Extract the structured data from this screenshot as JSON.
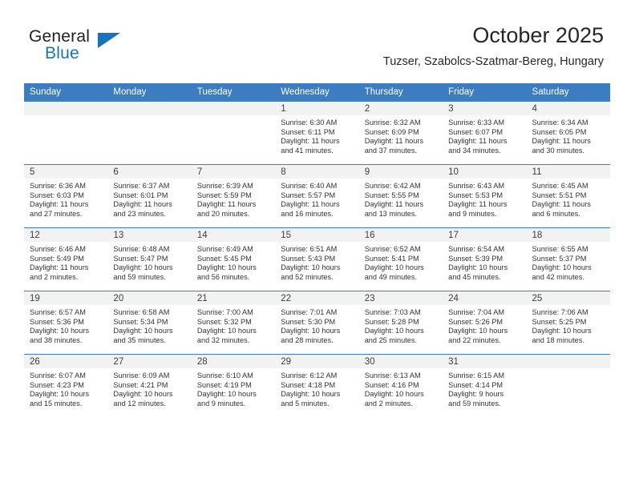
{
  "brand": {
    "name_part1": "General",
    "name_part2": "Blue",
    "accent_color": "#1c72ba"
  },
  "header": {
    "month_title": "October 2025",
    "location": "Tuzser, Szabolcs-Szatmar-Bereg, Hungary"
  },
  "calendar": {
    "header_bg": "#3b7dc0",
    "daynum_bg": "#f2f2f2",
    "weekday_headers": [
      "Sunday",
      "Monday",
      "Tuesday",
      "Wednesday",
      "Thursday",
      "Friday",
      "Saturday"
    ],
    "weeks": [
      [
        {
          "day": "",
          "empty": true
        },
        {
          "day": "",
          "empty": true
        },
        {
          "day": "",
          "empty": true
        },
        {
          "day": "1",
          "sunrise": "Sunrise: 6:30 AM",
          "sunset": "Sunset: 6:11 PM",
          "daylight_line1": "Daylight: 11 hours",
          "daylight_line2": "and 41 minutes."
        },
        {
          "day": "2",
          "sunrise": "Sunrise: 6:32 AM",
          "sunset": "Sunset: 6:09 PM",
          "daylight_line1": "Daylight: 11 hours",
          "daylight_line2": "and 37 minutes."
        },
        {
          "day": "3",
          "sunrise": "Sunrise: 6:33 AM",
          "sunset": "Sunset: 6:07 PM",
          "daylight_line1": "Daylight: 11 hours",
          "daylight_line2": "and 34 minutes."
        },
        {
          "day": "4",
          "sunrise": "Sunrise: 6:34 AM",
          "sunset": "Sunset: 6:05 PM",
          "daylight_line1": "Daylight: 11 hours",
          "daylight_line2": "and 30 minutes."
        }
      ],
      [
        {
          "day": "5",
          "sunrise": "Sunrise: 6:36 AM",
          "sunset": "Sunset: 6:03 PM",
          "daylight_line1": "Daylight: 11 hours",
          "daylight_line2": "and 27 minutes."
        },
        {
          "day": "6",
          "sunrise": "Sunrise: 6:37 AM",
          "sunset": "Sunset: 6:01 PM",
          "daylight_line1": "Daylight: 11 hours",
          "daylight_line2": "and 23 minutes."
        },
        {
          "day": "7",
          "sunrise": "Sunrise: 6:39 AM",
          "sunset": "Sunset: 5:59 PM",
          "daylight_line1": "Daylight: 11 hours",
          "daylight_line2": "and 20 minutes."
        },
        {
          "day": "8",
          "sunrise": "Sunrise: 6:40 AM",
          "sunset": "Sunset: 5:57 PM",
          "daylight_line1": "Daylight: 11 hours",
          "daylight_line2": "and 16 minutes."
        },
        {
          "day": "9",
          "sunrise": "Sunrise: 6:42 AM",
          "sunset": "Sunset: 5:55 PM",
          "daylight_line1": "Daylight: 11 hours",
          "daylight_line2": "and 13 minutes."
        },
        {
          "day": "10",
          "sunrise": "Sunrise: 6:43 AM",
          "sunset": "Sunset: 5:53 PM",
          "daylight_line1": "Daylight: 11 hours",
          "daylight_line2": "and 9 minutes."
        },
        {
          "day": "11",
          "sunrise": "Sunrise: 6:45 AM",
          "sunset": "Sunset: 5:51 PM",
          "daylight_line1": "Daylight: 11 hours",
          "daylight_line2": "and 6 minutes."
        }
      ],
      [
        {
          "day": "12",
          "sunrise": "Sunrise: 6:46 AM",
          "sunset": "Sunset: 5:49 PM",
          "daylight_line1": "Daylight: 11 hours",
          "daylight_line2": "and 2 minutes."
        },
        {
          "day": "13",
          "sunrise": "Sunrise: 6:48 AM",
          "sunset": "Sunset: 5:47 PM",
          "daylight_line1": "Daylight: 10 hours",
          "daylight_line2": "and 59 minutes."
        },
        {
          "day": "14",
          "sunrise": "Sunrise: 6:49 AM",
          "sunset": "Sunset: 5:45 PM",
          "daylight_line1": "Daylight: 10 hours",
          "daylight_line2": "and 56 minutes."
        },
        {
          "day": "15",
          "sunrise": "Sunrise: 6:51 AM",
          "sunset": "Sunset: 5:43 PM",
          "daylight_line1": "Daylight: 10 hours",
          "daylight_line2": "and 52 minutes."
        },
        {
          "day": "16",
          "sunrise": "Sunrise: 6:52 AM",
          "sunset": "Sunset: 5:41 PM",
          "daylight_line1": "Daylight: 10 hours",
          "daylight_line2": "and 49 minutes."
        },
        {
          "day": "17",
          "sunrise": "Sunrise: 6:54 AM",
          "sunset": "Sunset: 5:39 PM",
          "daylight_line1": "Daylight: 10 hours",
          "daylight_line2": "and 45 minutes."
        },
        {
          "day": "18",
          "sunrise": "Sunrise: 6:55 AM",
          "sunset": "Sunset: 5:37 PM",
          "daylight_line1": "Daylight: 10 hours",
          "daylight_line2": "and 42 minutes."
        }
      ],
      [
        {
          "day": "19",
          "sunrise": "Sunrise: 6:57 AM",
          "sunset": "Sunset: 5:36 PM",
          "daylight_line1": "Daylight: 10 hours",
          "daylight_line2": "and 38 minutes."
        },
        {
          "day": "20",
          "sunrise": "Sunrise: 6:58 AM",
          "sunset": "Sunset: 5:34 PM",
          "daylight_line1": "Daylight: 10 hours",
          "daylight_line2": "and 35 minutes."
        },
        {
          "day": "21",
          "sunrise": "Sunrise: 7:00 AM",
          "sunset": "Sunset: 5:32 PM",
          "daylight_line1": "Daylight: 10 hours",
          "daylight_line2": "and 32 minutes."
        },
        {
          "day": "22",
          "sunrise": "Sunrise: 7:01 AM",
          "sunset": "Sunset: 5:30 PM",
          "daylight_line1": "Daylight: 10 hours",
          "daylight_line2": "and 28 minutes."
        },
        {
          "day": "23",
          "sunrise": "Sunrise: 7:03 AM",
          "sunset": "Sunset: 5:28 PM",
          "daylight_line1": "Daylight: 10 hours",
          "daylight_line2": "and 25 minutes."
        },
        {
          "day": "24",
          "sunrise": "Sunrise: 7:04 AM",
          "sunset": "Sunset: 5:26 PM",
          "daylight_line1": "Daylight: 10 hours",
          "daylight_line2": "and 22 minutes."
        },
        {
          "day": "25",
          "sunrise": "Sunrise: 7:06 AM",
          "sunset": "Sunset: 5:25 PM",
          "daylight_line1": "Daylight: 10 hours",
          "daylight_line2": "and 18 minutes."
        }
      ],
      [
        {
          "day": "26",
          "sunrise": "Sunrise: 6:07 AM",
          "sunset": "Sunset: 4:23 PM",
          "daylight_line1": "Daylight: 10 hours",
          "daylight_line2": "and 15 minutes."
        },
        {
          "day": "27",
          "sunrise": "Sunrise: 6:09 AM",
          "sunset": "Sunset: 4:21 PM",
          "daylight_line1": "Daylight: 10 hours",
          "daylight_line2": "and 12 minutes."
        },
        {
          "day": "28",
          "sunrise": "Sunrise: 6:10 AM",
          "sunset": "Sunset: 4:19 PM",
          "daylight_line1": "Daylight: 10 hours",
          "daylight_line2": "and 9 minutes."
        },
        {
          "day": "29",
          "sunrise": "Sunrise: 6:12 AM",
          "sunset": "Sunset: 4:18 PM",
          "daylight_line1": "Daylight: 10 hours",
          "daylight_line2": "and 5 minutes."
        },
        {
          "day": "30",
          "sunrise": "Sunrise: 6:13 AM",
          "sunset": "Sunset: 4:16 PM",
          "daylight_line1": "Daylight: 10 hours",
          "daylight_line2": "and 2 minutes."
        },
        {
          "day": "31",
          "sunrise": "Sunrise: 6:15 AM",
          "sunset": "Sunset: 4:14 PM",
          "daylight_line1": "Daylight: 9 hours",
          "daylight_line2": "and 59 minutes."
        },
        {
          "day": "",
          "empty": true
        }
      ]
    ]
  }
}
